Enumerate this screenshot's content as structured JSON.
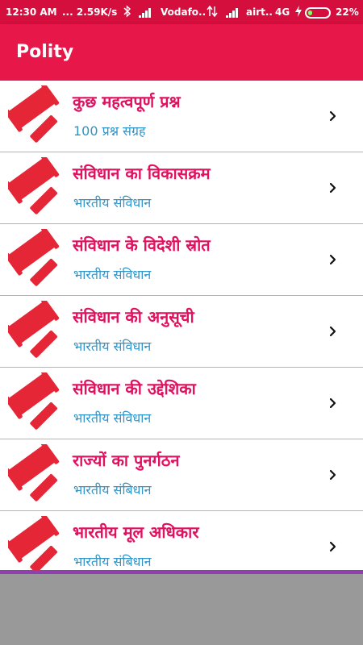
{
  "status_bar": {
    "time": "12:30 AM",
    "speed": "... 2.59K/s",
    "carrier1": "Vodafo..",
    "carrier2": "airt..",
    "network": "4G",
    "battery": "22%",
    "battery_level": 0.22,
    "icons": [
      "bluetooth-icon",
      "signal-icon",
      "data-arrows-icon",
      "signal-icon",
      "charging-icon",
      "battery-icon"
    ]
  },
  "app_bar": {
    "title": "Polity"
  },
  "list": {
    "icon": "gavel-icon",
    "trailing_icon": "chevron-right-icon",
    "items": [
      {
        "title": "कुछ महत्वपूर्ण प्रश्न",
        "subtitle": "100 प्रश्न संग्रह"
      },
      {
        "title": "संविधान का विकासक्रम",
        "subtitle": "भारतीय संविधान"
      },
      {
        "title": "संविधान के विदेशी स्रोत",
        "subtitle": "भारतीय संविधान"
      },
      {
        "title": "संविधान की अनुसूची",
        "subtitle": "भारतीय संविधान"
      },
      {
        "title": "संविधान की उद्देशिका",
        "subtitle": "भारतीय संविधान"
      },
      {
        "title": "राज्यों का पुनर्गठन",
        "subtitle": "भारतीय संबिधान"
      },
      {
        "title": "भारतीय मूल अधिकार",
        "subtitle": "भारतीय संबिधान"
      }
    ]
  },
  "colors": {
    "status_bar": "#d50f3d",
    "app_bar": "#e8174a",
    "title_text": "#e0115f",
    "subtitle_text": "#2f95c9",
    "gavel": "#e52637",
    "accent_line": "#8f3fb0",
    "bottom_area": "#999999"
  }
}
